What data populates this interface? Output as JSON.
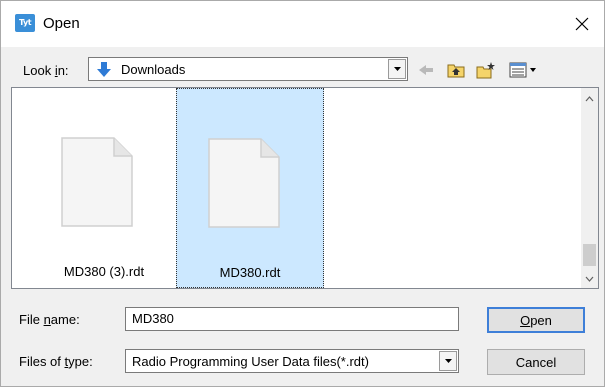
{
  "window": {
    "app_icon_text": "Tytera",
    "title": "Open",
    "close_icon": "close-icon"
  },
  "look_in": {
    "label_pre": "Look ",
    "label_accel": "i",
    "label_post": "n:",
    "value": "Downloads",
    "folder_icon": "download-arrow-icon"
  },
  "toolbar": {
    "icons": [
      "back-arrow-icon",
      "up-folder-icon",
      "new-folder-icon",
      "view-menu-icon"
    ]
  },
  "files": [
    {
      "name": "MD380 (3).rdt",
      "selected": false
    },
    {
      "name": "MD380.rdt",
      "selected": true
    }
  ],
  "file_name": {
    "label_pre": "File ",
    "label_accel": "n",
    "label_post": "ame:",
    "value": "MD380"
  },
  "files_of_type": {
    "label_pre": "Files of ",
    "label_accel": "t",
    "label_post": "ype:",
    "value": "Radio Programming User Data files(*.rdt)"
  },
  "buttons": {
    "open_accel": "O",
    "open_rest": "pen",
    "cancel": "Cancel"
  },
  "colors": {
    "selection": "#cce8ff",
    "accent": "#3e7fd8"
  }
}
